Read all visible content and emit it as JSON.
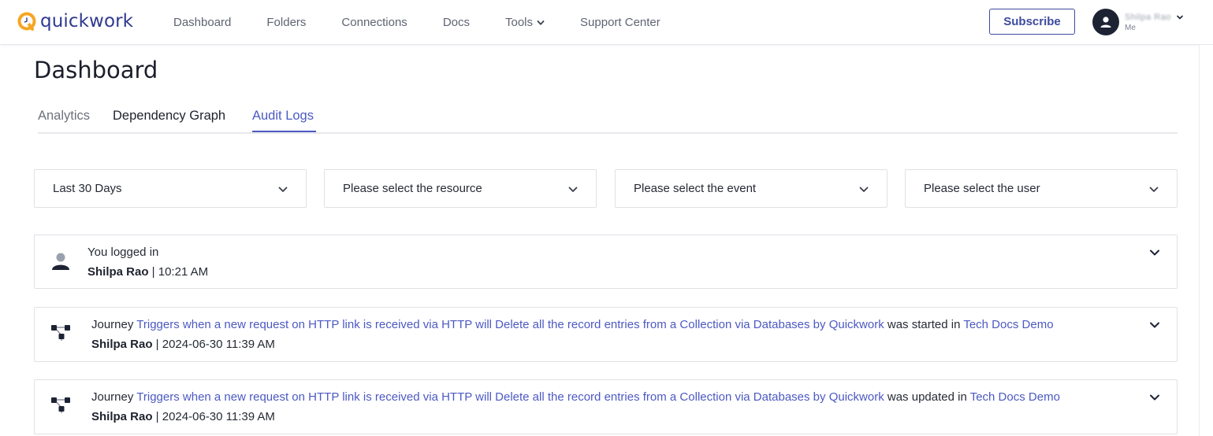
{
  "brand": {
    "name": "quickwork"
  },
  "nav": [
    {
      "label": "Dashboard"
    },
    {
      "label": "Folders"
    },
    {
      "label": "Connections"
    },
    {
      "label": "Docs"
    },
    {
      "label": "Tools"
    },
    {
      "label": "Support Center"
    }
  ],
  "header": {
    "subscribe_label": "Subscribe",
    "profile_name": "Shilpa Rao",
    "profile_sub": "Me"
  },
  "page": {
    "title": "Dashboard"
  },
  "tabs": [
    {
      "label": "Analytics",
      "active": false
    },
    {
      "label": "Dependency Graph",
      "active": false
    },
    {
      "label": "Audit Logs",
      "active": true
    }
  ],
  "filters": {
    "period": "Last 30 Days",
    "resource": "Please select the resource",
    "event": "Please select the event",
    "user": "Please select the user"
  },
  "logs": [
    {
      "icon": "user-icon",
      "text": "You logged in",
      "user": "Shilpa Rao",
      "separator": " | ",
      "time": "10:21 AM"
    },
    {
      "icon": "journey-icon",
      "prefix": "Journey ",
      "journey": "Triggers when a new request on HTTP link is received via HTTP will Delete all the record entries from a Collection via Databases by Quickwork",
      "action": " was started in ",
      "project": "Tech Docs Demo",
      "user": "Shilpa Rao",
      "separator": " | ",
      "time": "2024-06-30 11:39 AM"
    },
    {
      "icon": "journey-icon",
      "prefix": "Journey ",
      "journey": "Triggers when a new request on HTTP link is received via HTTP will Delete all the record entries from a Collection via Databases by Quickwork",
      "action": " was updated in ",
      "project": "Tech Docs Demo",
      "user": "Shilpa Rao",
      "separator": " | ",
      "time": "2024-06-30 11:39 AM"
    }
  ],
  "colors": {
    "accent": "#4c59c2",
    "brand": "#2f3a8f",
    "logo_orange": "#f5a623"
  }
}
